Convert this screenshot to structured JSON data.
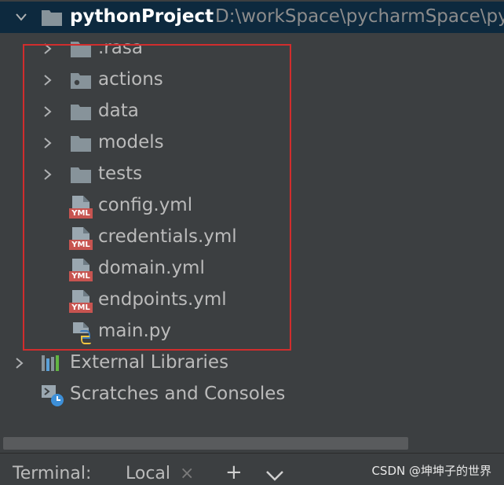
{
  "project": {
    "name": "pythonProject",
    "path": "D:\\workSpace\\pycharmSpace\\py"
  },
  "items": [
    {
      "label": ".rasa",
      "icon": "folder-icon"
    },
    {
      "label": "actions",
      "icon": "package-folder-icon"
    },
    {
      "label": "data",
      "icon": "folder-icon"
    },
    {
      "label": "models",
      "icon": "folder-icon"
    },
    {
      "label": "tests",
      "icon": "folder-icon"
    },
    {
      "label": "config.yml",
      "icon": "yml-file-icon"
    },
    {
      "label": "credentials.yml",
      "icon": "yml-file-icon"
    },
    {
      "label": "domain.yml",
      "icon": "yml-file-icon"
    },
    {
      "label": "endpoints.yml",
      "icon": "yml-file-icon"
    },
    {
      "label": "main.py",
      "icon": "python-file-icon"
    }
  ],
  "yml_badge": "YML",
  "external_libraries": "External Libraries",
  "scratches": "Scratches and Consoles",
  "terminal": {
    "label": "Terminal:",
    "tab": "Local",
    "close": "×",
    "add": "+"
  },
  "watermark": "CSDN @坤坤子的世界",
  "colors": {
    "background": "#3c3f41",
    "selection": "#0d293e",
    "annotation_border": "#d12d2d",
    "folder": "#87939a",
    "yml_badge": "#c75450"
  }
}
